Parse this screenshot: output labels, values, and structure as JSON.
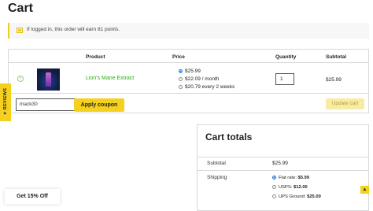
{
  "page": {
    "title": "Cart"
  },
  "notice": {
    "text": "If logged in, this order will earn 81 points."
  },
  "table": {
    "headers": {
      "product": "Product",
      "price": "Price",
      "quantity": "Quantity",
      "subtotal": "Subtotal"
    },
    "rows": [
      {
        "remove": "×",
        "product_name": "Lion's Mane Extract",
        "price_options": [
          "$25.99",
          "$22.09 / month",
          "$20.79 every 2 weeks"
        ],
        "selected_price_index": 0,
        "quantity": "1",
        "subtotal": "$25.99"
      }
    ]
  },
  "coupon": {
    "value": "mack30",
    "apply_label": "Apply coupon"
  },
  "update_cart_label": "Update cart",
  "reviews_tab": {
    "label": "★ REVIEWS"
  },
  "totals": {
    "title": "Cart totals",
    "subtotal_label": "Subtotal",
    "subtotal_value": "$25.99",
    "shipping_label": "Shipping",
    "shipping_options": [
      {
        "name": "Flat rate:",
        "price": "$5.99",
        "selected": true
      },
      {
        "name": "USPS:",
        "price": "$12.00",
        "selected": false
      },
      {
        "name": "UPS Ground:",
        "price": "$25.00",
        "selected": false
      }
    ]
  },
  "promo": {
    "label": "Get 15% Off"
  },
  "scroll_top_glyph": "▲",
  "colors": {
    "accent_yellow": "#f5d01f",
    "link_green": "#27b30a",
    "radio_blue": "#1a73e8"
  }
}
